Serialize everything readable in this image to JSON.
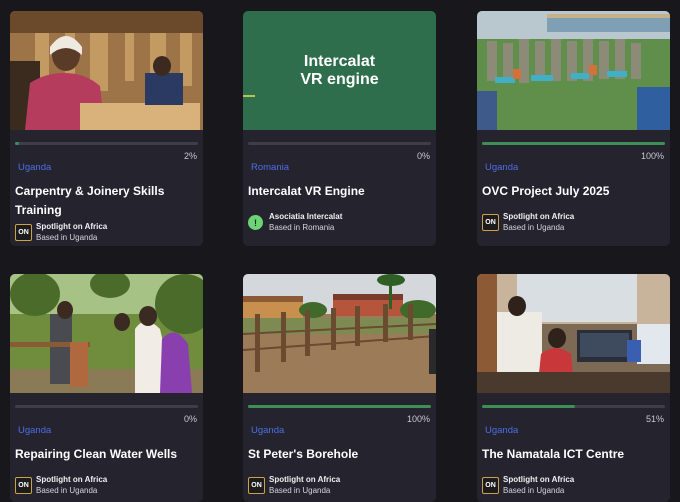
{
  "cards": [
    {
      "country": "Uganda",
      "progress": 2,
      "progress_label": "2%",
      "title": "Carpentry & Joinery Skills Training",
      "org_name": "Spotlight on Africa",
      "org_base": "Based in Uganda",
      "org_logo_icon": "spotlight-on-africa-logo"
    },
    {
      "country": "Romania",
      "progress": 0,
      "progress_label": "0%",
      "title": "Intercalat VR Engine",
      "image_text_line1": "Intercalat",
      "image_text_line2": "VR engine",
      "org_name": "Asociatia Intercalat",
      "org_base": "Based in Romania",
      "org_logo_icon": "asociatia-intercalat-logo"
    },
    {
      "country": "Uganda",
      "progress": 100,
      "progress_label": "100%",
      "title": "OVC Project July 2025",
      "org_name": "Spotlight on Africa",
      "org_base": "Based in Uganda",
      "org_logo_icon": "spotlight-on-africa-logo"
    },
    {
      "country": "Uganda",
      "progress": 0,
      "progress_label": "0%",
      "title": "Repairing Clean Water Wells",
      "org_name": "Spotlight on Africa",
      "org_base": "Based in Uganda",
      "org_logo_icon": "spotlight-on-africa-logo"
    },
    {
      "country": "Uganda",
      "progress": 100,
      "progress_label": "100%",
      "title": "St Peter's Borehole",
      "org_name": "Spotlight on Africa",
      "org_base": "Based in Uganda",
      "org_logo_icon": "spotlight-on-africa-logo"
    },
    {
      "country": "Uganda",
      "progress": 51,
      "progress_label": "51%",
      "title": "The Namatala ICT Centre",
      "org_name": "Spotlight on Africa",
      "org_base": "Based in Uganda",
      "org_logo_icon": "spotlight-on-africa-logo"
    }
  ],
  "logos": {
    "spotlight_text": "ON",
    "intercalat_text": "!"
  },
  "colors": {
    "background": "#17171c",
    "card": "#24232e",
    "progress_fill": "#3c8f55",
    "country_link": "#4d6ee6",
    "intercalat_green": "#2f6e4d"
  }
}
